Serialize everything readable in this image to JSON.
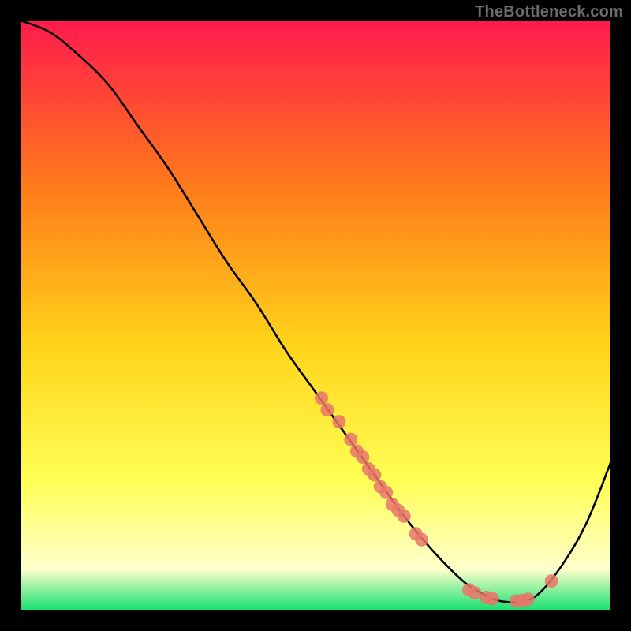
{
  "attribution": "TheBottleneck.com",
  "colors": {
    "background": "#000000",
    "gradient_top": "#ff1a4d",
    "gradient_mid1": "#ff7a1a",
    "gradient_mid2": "#ffd41a",
    "gradient_mid3": "#ffff55",
    "gradient_bottom1": "#ffffcc",
    "gradient_bottom2": "#15e06f",
    "curve": "#000000",
    "point_fill": "#e9756b",
    "point_stroke": "#a63d37",
    "attribution_text": "#6b6b6b"
  },
  "chart_data": {
    "type": "line",
    "title": "",
    "xlabel": "",
    "ylabel": "",
    "xlim": [
      0,
      100
    ],
    "ylim": [
      0,
      100
    ],
    "series": [
      {
        "name": "bottleneck-curve",
        "x": [
          0,
          5,
          10,
          15,
          20,
          25,
          30,
          35,
          40,
          45,
          50,
          55,
          60,
          65,
          70,
          75,
          78,
          80,
          82,
          85,
          88,
          92,
          96,
          100
        ],
        "y": [
          100,
          98,
          94,
          89,
          82,
          75,
          67,
          59,
          52,
          44,
          37,
          30,
          23,
          16,
          10,
          5,
          3,
          2,
          1.5,
          1.5,
          3,
          8,
          15,
          25
        ]
      }
    ],
    "scatter_points": [
      {
        "name": "pt1",
        "x": 51,
        "y": 36
      },
      {
        "name": "pt2",
        "x": 52,
        "y": 34
      },
      {
        "name": "pt3",
        "x": 54,
        "y": 32
      },
      {
        "name": "pt4",
        "x": 56,
        "y": 29
      },
      {
        "name": "pt5",
        "x": 57,
        "y": 27
      },
      {
        "name": "pt6",
        "x": 58,
        "y": 26
      },
      {
        "name": "pt7",
        "x": 59,
        "y": 24
      },
      {
        "name": "pt8",
        "x": 60,
        "y": 23
      },
      {
        "name": "pt9",
        "x": 61,
        "y": 21
      },
      {
        "name": "pt10",
        "x": 62,
        "y": 20
      },
      {
        "name": "pt11",
        "x": 63,
        "y": 18
      },
      {
        "name": "pt12",
        "x": 64,
        "y": 17
      },
      {
        "name": "pt13",
        "x": 65,
        "y": 16
      },
      {
        "name": "pt14",
        "x": 67,
        "y": 13
      },
      {
        "name": "pt15",
        "x": 68,
        "y": 12
      },
      {
        "name": "pt16",
        "x": 76,
        "y": 3.5
      },
      {
        "name": "pt17",
        "x": 77,
        "y": 3
      },
      {
        "name": "pt18",
        "x": 79,
        "y": 2.2
      },
      {
        "name": "pt19",
        "x": 80,
        "y": 2
      },
      {
        "name": "pt20",
        "x": 84,
        "y": 1.6
      },
      {
        "name": "pt21",
        "x": 85,
        "y": 1.7
      },
      {
        "name": "pt22",
        "x": 86,
        "y": 1.9
      },
      {
        "name": "pt23",
        "x": 90,
        "y": 5
      }
    ]
  }
}
